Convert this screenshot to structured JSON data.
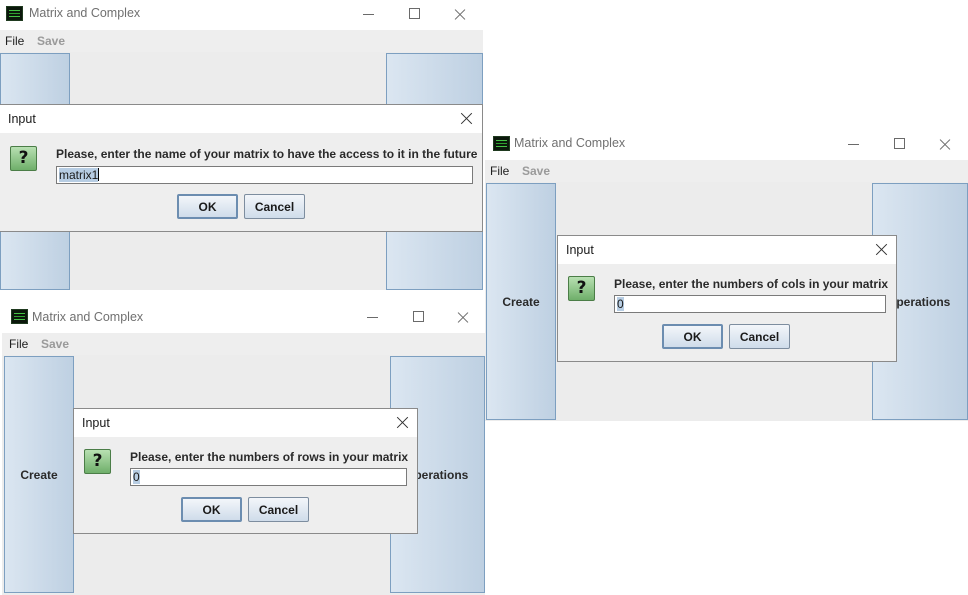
{
  "app": {
    "title": "Matrix and Complex",
    "icon": "app-matrix-icon",
    "menu": {
      "file": "File",
      "save": "Save"
    },
    "buttons": {
      "create": "Create",
      "operations": "Operations"
    }
  },
  "dialogs": {
    "name_dialog": {
      "title": "Input",
      "message": "Please, enter the name of your matrix to have the access to it in the future",
      "value": "matrix1",
      "ok": "OK",
      "cancel": "Cancel"
    },
    "rows_dialog": {
      "title": "Input",
      "message": "Please, enter the numbers of rows in your matrix",
      "value": "0",
      "ok": "OK",
      "cancel": "Cancel"
    },
    "cols_dialog": {
      "title": "Input",
      "message": "Please, enter the numbers of cols in your matrix",
      "value": "0",
      "ok": "OK",
      "cancel": "Cancel"
    }
  },
  "icons": {
    "question": "question-icon",
    "question_glyph": "?"
  },
  "colors": {
    "side_button_light": "#dbe6f1",
    "side_button_dark": "#bed0e2",
    "question_icon_green": "#6faf6a",
    "selection": "#b7cde3"
  }
}
